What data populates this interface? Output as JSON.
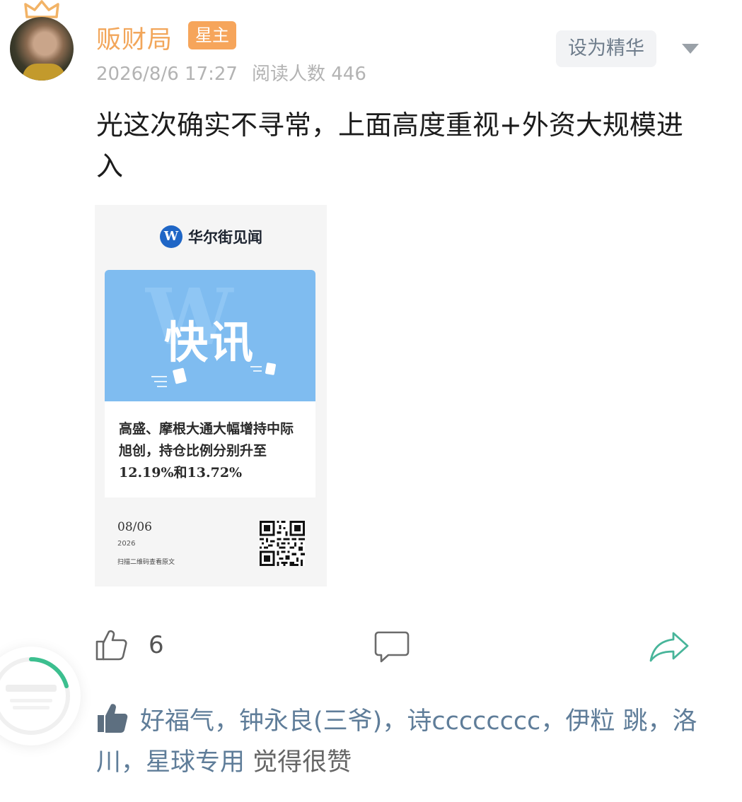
{
  "post": {
    "author": "贩财局",
    "badge": "星主",
    "date": "2026/8/6 17:27",
    "reads": "阅读人数 446",
    "essence_button": "设为精华",
    "text": "光这次确实不寻常，上面高度重视+外资大规模进入"
  },
  "image_card": {
    "brand_logo": "W",
    "brand": "华尔街见闻",
    "watermark": "W",
    "banner_title": "快讯",
    "headline": "高盛、摩根大通大幅增持中际旭创，持仓比例分别升至12.19%和13.72%",
    "date": "08/06",
    "year": "2026",
    "scan_hint": "扫描二维码查看原文"
  },
  "actions": {
    "like_count": "6",
    "like_icon": "thumb-up-outline-icon",
    "comment_icon": "comment-bubble-icon",
    "share_icon": "share-arrow-icon"
  },
  "likers": {
    "names": [
      "好福气",
      "钟永良(三爷)",
      "诗cccccccc",
      "伊粒 跳",
      "洛川",
      "星球专用"
    ],
    "separator": "，",
    "suffix": " 觉得很赞"
  },
  "colors": {
    "author": "#f2a65a",
    "badge_bg": "#f6a55b",
    "link": "#5f7d99",
    "share": "#48b59a",
    "banner": "#7fbcf0"
  }
}
